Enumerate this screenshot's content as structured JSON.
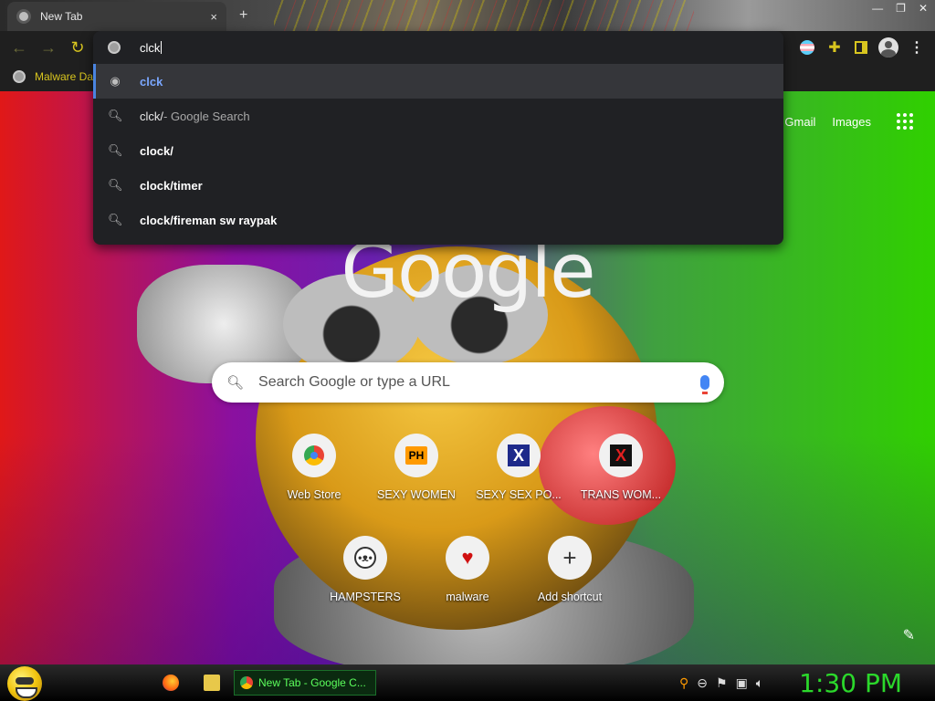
{
  "browser": {
    "tab_title": "New Tab",
    "tab_close_glyph": "×",
    "new_tab_glyph": "+",
    "bookmark": "Malware Da",
    "omnibox_text": "clck",
    "accent_color": "#d8c51f"
  },
  "suggestions": [
    {
      "icon": "globe-icon",
      "text": "clck",
      "suffix": "",
      "selected": true
    },
    {
      "icon": "search-icon",
      "text": "clck/",
      "suffix": " - Google Search",
      "selected": false
    },
    {
      "icon": "search-icon",
      "text": "clock/",
      "suffix": "",
      "selected": false
    },
    {
      "icon": "search-icon",
      "text": "clock/timer",
      "suffix": "",
      "selected": false
    },
    {
      "icon": "search-icon",
      "text": "clock/fireman sw raypak",
      "suffix": "",
      "selected": false
    }
  ],
  "newtab": {
    "gmail": "Gmail",
    "images": "Images",
    "logo": "Google",
    "search_placeholder": "Search Google or type a URL",
    "shortcuts": [
      {
        "label": "Web Store",
        "icon": "web-store-icon"
      },
      {
        "label": "SEXY WOMEN",
        "icon": "ph-icon",
        "glyph": "PH"
      },
      {
        "label": "SEXY SEX PO...",
        "icon": "x-icon",
        "glyph": "X"
      },
      {
        "label": "TRANS WOM...",
        "icon": "x-red-icon",
        "glyph": "X"
      },
      {
        "label": "HAMPSTERS",
        "icon": "hamster-icon",
        "glyph": "ʕ•ᴥ•ʔ"
      },
      {
        "label": "malware",
        "icon": "heart-icon",
        "glyph": "♥"
      },
      {
        "label": "Add shortcut",
        "icon": "plus-icon",
        "glyph": "+"
      }
    ]
  },
  "taskbar": {
    "task_label": "New Tab - Google C...",
    "clock": "1:30 PM"
  }
}
